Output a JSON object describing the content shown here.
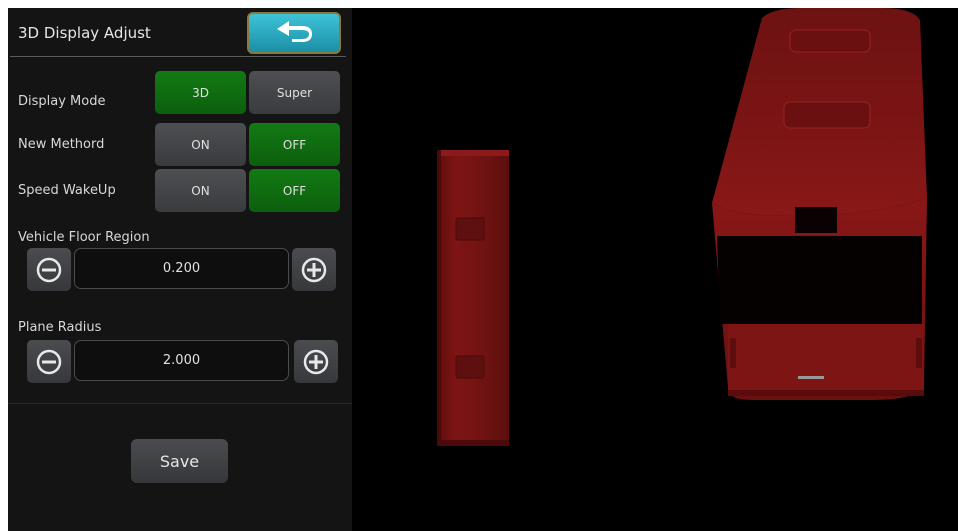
{
  "panel": {
    "title": "3D Display Adjust",
    "back_icon": "back-arrow-icon",
    "rows": [
      {
        "label": "Display Mode",
        "options": [
          "3D",
          "Super"
        ],
        "selected": 0
      },
      {
        "label": "New Methord",
        "options": [
          "ON",
          "OFF"
        ],
        "selected": 1
      },
      {
        "label": "Speed WakeUp",
        "options": [
          "ON",
          "OFF"
        ],
        "selected": 1
      }
    ],
    "vehicle_floor_region": {
      "label": "Vehicle Floor Region",
      "value": "0.200"
    },
    "plane_radius": {
      "label": "Plane Radius",
      "value": "2.000"
    },
    "save_label": "Save"
  },
  "colors": {
    "selected": "#137a14",
    "unselected": "#46484b",
    "back_button": "#2bb0c6",
    "vehicle": "#7a1212"
  }
}
